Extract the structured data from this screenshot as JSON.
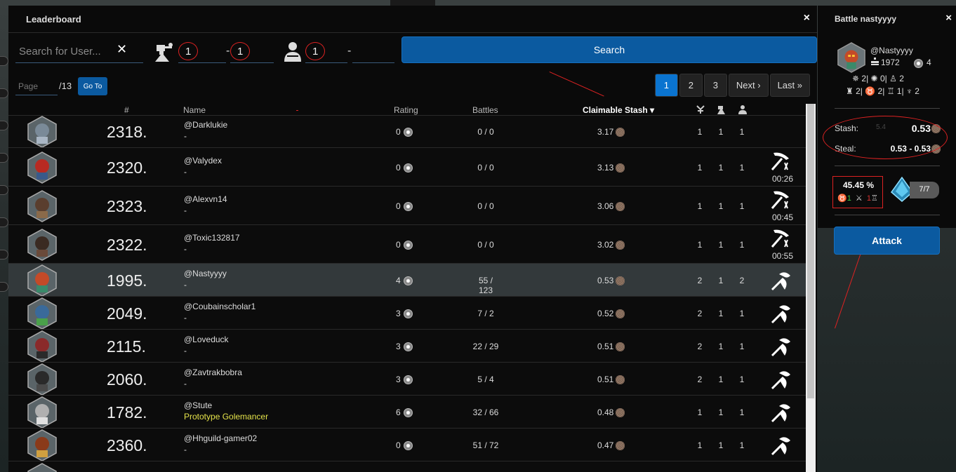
{
  "leaderboard": {
    "title": "Leaderboard",
    "close_label": "×",
    "search_placeholder": "Search for User...",
    "clear_label": "✕",
    "filter_a_min": "1",
    "filter_a_max": "1",
    "filter_b_min": "1",
    "filter_b_max": "",
    "search_label": "Search",
    "page_placeholder": "Page",
    "page_total": "/13",
    "goto_label": "Go To",
    "pages": [
      "1",
      "2",
      "3"
    ],
    "active_page": "1",
    "next_label": "Next ›",
    "last_label": "Last »",
    "columns": {
      "rank": "#",
      "name": "Name",
      "rating": "Rating",
      "battles": "Battles",
      "stash": "Claimable Stash ▾"
    },
    "rows": [
      {
        "rank": "2318.",
        "name": "@Darklukie",
        "sub": "-",
        "rating": "0",
        "battles": "0 / 0",
        "stash": "3.17",
        "c1": "1",
        "c2": "1",
        "c3": "1",
        "timer": "",
        "action": "none"
      },
      {
        "rank": "2320.",
        "name": "@Valydex",
        "sub": "-",
        "rating": "0",
        "battles": "0 / 0",
        "stash": "3.13",
        "c1": "1",
        "c2": "1",
        "c3": "1",
        "timer": "00:26",
        "action": "cooldown"
      },
      {
        "rank": "2323.",
        "name": "@Alexvn14",
        "sub": "-",
        "rating": "0",
        "battles": "0 / 0",
        "stash": "3.06",
        "c1": "1",
        "c2": "1",
        "c3": "1",
        "timer": "00:45",
        "action": "cooldown"
      },
      {
        "rank": "2322.",
        "name": "@Toxic132817",
        "sub": "-",
        "rating": "0",
        "battles": "0 / 0",
        "stash": "3.02",
        "c1": "1",
        "c2": "1",
        "c3": "1",
        "timer": "00:55",
        "action": "cooldown"
      },
      {
        "rank": "1995.",
        "name": "@Nastyyyy",
        "sub": "-",
        "rating": "4",
        "battles": "55 / 123",
        "stash": "0.53",
        "c1": "2",
        "c2": "1",
        "c3": "2",
        "timer": "",
        "action": "attack"
      },
      {
        "rank": "2049.",
        "name": "@Coubainscholar1",
        "sub": "-",
        "rating": "3",
        "battles": "7 / 2",
        "stash": "0.52",
        "c1": "2",
        "c2": "1",
        "c3": "1",
        "timer": "",
        "action": "attack"
      },
      {
        "rank": "2115.",
        "name": "@Loveduck",
        "sub": "-",
        "rating": "3",
        "battles": "22 / 29",
        "stash": "0.51",
        "c1": "2",
        "c2": "1",
        "c3": "1",
        "timer": "",
        "action": "attack"
      },
      {
        "rank": "2060.",
        "name": "@Zavtrakbobra",
        "sub": "-",
        "rating": "3",
        "battles": "5 / 4",
        "stash": "0.51",
        "c1": "2",
        "c2": "1",
        "c3": "1",
        "timer": "",
        "action": "attack"
      },
      {
        "rank": "1782.",
        "name": "@Stute",
        "sub": "Prototype Golemancer",
        "rating": "6",
        "battles": "32 / 66",
        "stash": "0.48",
        "c1": "1",
        "c2": "1",
        "c3": "1",
        "timer": "",
        "action": "attack"
      },
      {
        "rank": "2360.",
        "name": "@Hhguild-gamer02",
        "sub": "-",
        "rating": "0",
        "battles": "51 / 72",
        "stash": "0.47",
        "c1": "1",
        "c2": "1",
        "c3": "1",
        "timer": "",
        "action": "attack"
      }
    ]
  },
  "battle": {
    "title": "Battle nastyyyy",
    "close_label": "×",
    "username": "@Nastyyyy",
    "rank_value": "1972",
    "rating_value": "4",
    "stats_line1": [
      "2",
      "0",
      "2"
    ],
    "stats_line2": [
      "2",
      "2",
      "1",
      "2"
    ],
    "stash_label": "Stash:",
    "stash_value": "0.53",
    "stash_ghost": "5.4",
    "steal_label": "Steal:",
    "steal_value": "0.53 - 0.53",
    "win_pct": "45.45 %",
    "win_a": "1",
    "win_b": "1",
    "energy": "7/7",
    "attack_label": "Attack"
  },
  "colors": {
    "accent": "#0b5aa0",
    "active_page": "#0a74d0",
    "annotation": "#dd2222",
    "title_yellow": "#e4e24a"
  }
}
